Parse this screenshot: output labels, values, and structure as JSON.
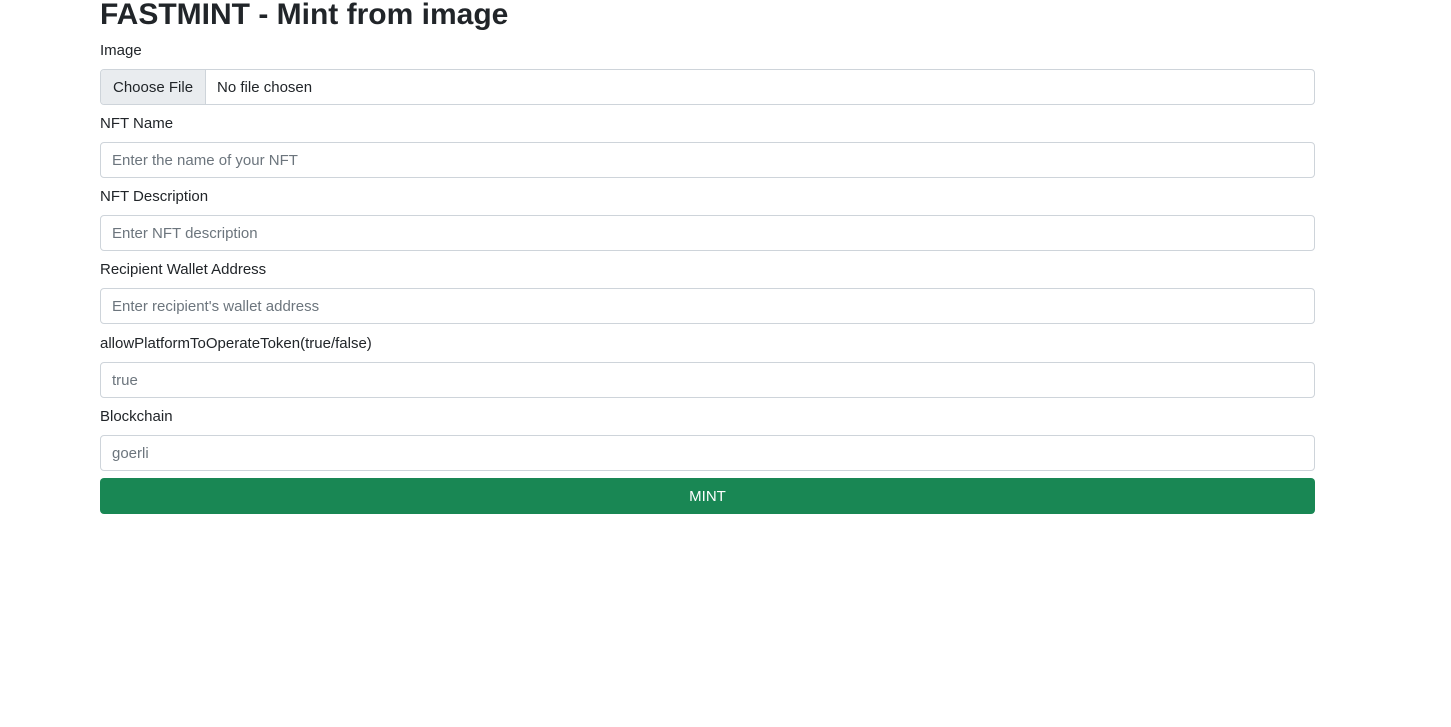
{
  "page": {
    "title": "FASTMINT - Mint from image"
  },
  "form": {
    "image": {
      "label": "Image",
      "button_label": "Choose File",
      "status": "No file chosen"
    },
    "nft_name": {
      "label": "NFT Name",
      "value": "",
      "placeholder": "Enter the name of your NFT"
    },
    "nft_description": {
      "label": "NFT Description",
      "value": "",
      "placeholder": "Enter NFT description"
    },
    "recipient_wallet": {
      "label": "Recipient Wallet Address",
      "value": "",
      "placeholder": "Enter recipient's wallet address"
    },
    "allow_platform": {
      "label": "allowPlatformToOperateToken(true/false)",
      "value": "",
      "placeholder": "true"
    },
    "blockchain": {
      "label": "Blockchain",
      "value": "",
      "placeholder": "goerli"
    },
    "submit_label": "MINT"
  },
  "colors": {
    "primary_button": "#198754",
    "input_border": "#ced4da",
    "file_button_bg": "#e9ecef"
  }
}
